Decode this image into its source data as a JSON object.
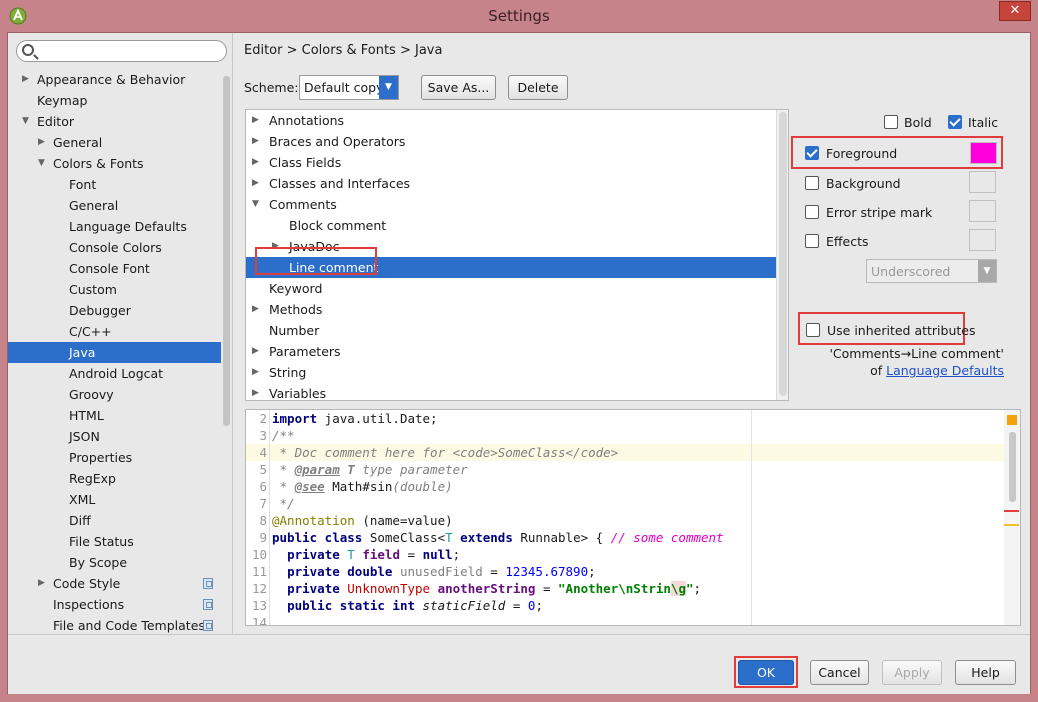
{
  "window": {
    "title": "Settings",
    "close_symbol": "✕"
  },
  "search": {
    "placeholder": "",
    "value": ""
  },
  "sidebar": {
    "items": [
      {
        "label": "Appearance & Behavior",
        "level": 0,
        "arrow": "▶"
      },
      {
        "label": "Keymap",
        "level": 0,
        "arrow": ""
      },
      {
        "label": "Editor",
        "level": 0,
        "arrow": "▼"
      },
      {
        "label": "General",
        "level": 1,
        "arrow": "▶"
      },
      {
        "label": "Colors & Fonts",
        "level": 1,
        "arrow": "▼"
      },
      {
        "label": "Font",
        "level": 2,
        "arrow": ""
      },
      {
        "label": "General",
        "level": 2,
        "arrow": ""
      },
      {
        "label": "Language Defaults",
        "level": 2,
        "arrow": ""
      },
      {
        "label": "Console Colors",
        "level": 2,
        "arrow": ""
      },
      {
        "label": "Console Font",
        "level": 2,
        "arrow": ""
      },
      {
        "label": "Custom",
        "level": 2,
        "arrow": ""
      },
      {
        "label": "Debugger",
        "level": 2,
        "arrow": ""
      },
      {
        "label": "C/C++",
        "level": 2,
        "arrow": ""
      },
      {
        "label": "Java",
        "level": 2,
        "arrow": "",
        "selected": true
      },
      {
        "label": "Android Logcat",
        "level": 2,
        "arrow": ""
      },
      {
        "label": "Groovy",
        "level": 2,
        "arrow": ""
      },
      {
        "label": "HTML",
        "level": 2,
        "arrow": ""
      },
      {
        "label": "JSON",
        "level": 2,
        "arrow": ""
      },
      {
        "label": "Properties",
        "level": 2,
        "arrow": ""
      },
      {
        "label": "RegExp",
        "level": 2,
        "arrow": ""
      },
      {
        "label": "XML",
        "level": 2,
        "arrow": ""
      },
      {
        "label": "Diff",
        "level": 2,
        "arrow": ""
      },
      {
        "label": "File Status",
        "level": 2,
        "arrow": ""
      },
      {
        "label": "By Scope",
        "level": 2,
        "arrow": ""
      },
      {
        "label": "Code Style",
        "level": 1,
        "arrow": "▶",
        "page_icon": true
      },
      {
        "label": "Inspections",
        "level": 1,
        "arrow": "",
        "page_icon": true
      },
      {
        "label": "File and Code Templates",
        "level": 1,
        "arrow": "",
        "page_icon": true
      }
    ]
  },
  "breadcrumb": "Editor > Colors & Fonts > Java",
  "scheme": {
    "label": "Scheme:",
    "value": "Default copy",
    "save_as_label": "Save As...",
    "delete_label": "Delete"
  },
  "attributes": [
    {
      "label": "Annotations",
      "level": 0,
      "arrow": "▶"
    },
    {
      "label": "Braces and Operators",
      "level": 0,
      "arrow": "▶"
    },
    {
      "label": "Class Fields",
      "level": 0,
      "arrow": "▶"
    },
    {
      "label": "Classes and Interfaces",
      "level": 0,
      "arrow": "▶"
    },
    {
      "label": "Comments",
      "level": 0,
      "arrow": "▼"
    },
    {
      "label": "Block comment",
      "level": 1,
      "arrow": ""
    },
    {
      "label": "JavaDoc",
      "level": 1,
      "arrow": "▶"
    },
    {
      "label": "Line comment",
      "level": 1,
      "arrow": "",
      "selected": true
    },
    {
      "label": "Keyword",
      "level": 0,
      "arrow": ""
    },
    {
      "label": "Methods",
      "level": 0,
      "arrow": "▶"
    },
    {
      "label": "Number",
      "level": 0,
      "arrow": ""
    },
    {
      "label": "Parameters",
      "level": 0,
      "arrow": "▶"
    },
    {
      "label": "String",
      "level": 0,
      "arrow": "▶"
    },
    {
      "label": "Variables",
      "level": 0,
      "arrow": "▶"
    }
  ],
  "options": {
    "bold_label": "Bold",
    "bold_checked": false,
    "italic_label": "Italic",
    "italic_checked": true,
    "foreground_label": "Foreground",
    "foreground_checked": true,
    "foreground_color": "#ff00dc",
    "background_label": "Background",
    "background_checked": false,
    "error_stripe_label": "Error stripe mark",
    "error_stripe_checked": false,
    "effects_label": "Effects",
    "effects_checked": false,
    "effects_type": "Underscored",
    "use_inherited_label": "Use inherited attributes",
    "use_inherited_checked": false,
    "inherit_note_line1": "'Comments→Line comment'",
    "inherit_note_of": "of",
    "inherit_note_link": "Language Defaults"
  },
  "code_preview": {
    "lines": [
      {
        "num": "2",
        "html": "<span class=\"k\">import</span> java.util.Date;"
      },
      {
        "num": "3",
        "html": "<span class=\"c\">/**</span>"
      },
      {
        "num": "4",
        "html": "<span class=\"c\"> * Doc comment here for </span><span class=\"tag\">&lt;code&gt;</span><span class=\"c\">SomeClass</span><span class=\"tag\">&lt;/code&gt;</span>",
        "highlight": true
      },
      {
        "num": "5",
        "html": "<span class=\"c\"> * <b><u>@param</u></b> <b>T</b> type parameter</span>"
      },
      {
        "num": "6",
        "html": "<span class=\"c\"> * <b><u>@see</u></b> </span>Math#<span>sin</span><span class=\"c\">(double)</span>"
      },
      {
        "num": "7",
        "html": "<span class=\"c\"> */</span>"
      },
      {
        "num": "8",
        "html": "<span class=\"ann\">@Annotation</span> (name=value)"
      },
      {
        "num": "9",
        "html": "<span class=\"k\">public class</span> SomeClass&lt;<span style=\"color:#20999d\">T</span> <span class=\"k\">extends</span> Runnable&gt; { <span class=\"lc\">// some comment</span>"
      },
      {
        "num": "10",
        "html": "  <span class=\"k\">private</span> <span style=\"color:#20999d\">T</span> <span class=\"f\">field</span> = <span class=\"k\">null</span>;"
      },
      {
        "num": "11",
        "html": "  <span class=\"k\">private double</span> <span class=\"u\">unusedField</span> = <span class=\"n\">12345.67890</span>;"
      },
      {
        "num": "12",
        "html": "  <span class=\"k\">private</span> <span class=\"unk\">UnknownType</span> <span class=\"f\">anotherString</span> = <span class=\"s\">\"Another\\nStrin<span style=\"background:#f6d8d8\">\\g</span>\"</span>;"
      },
      {
        "num": "13",
        "html": "  <span class=\"k\">public static int</span> <i>staticField</i> = <span class=\"n\">0</span>;"
      },
      {
        "num": "14",
        "html": ""
      }
    ]
  },
  "footer": {
    "ok_label": "OK",
    "cancel_label": "Cancel",
    "apply_label": "Apply",
    "help_label": "Help"
  },
  "colors": {
    "selection": "#2c6fca",
    "highlight_box": "#e03c3c",
    "frame": "#c7838a"
  }
}
